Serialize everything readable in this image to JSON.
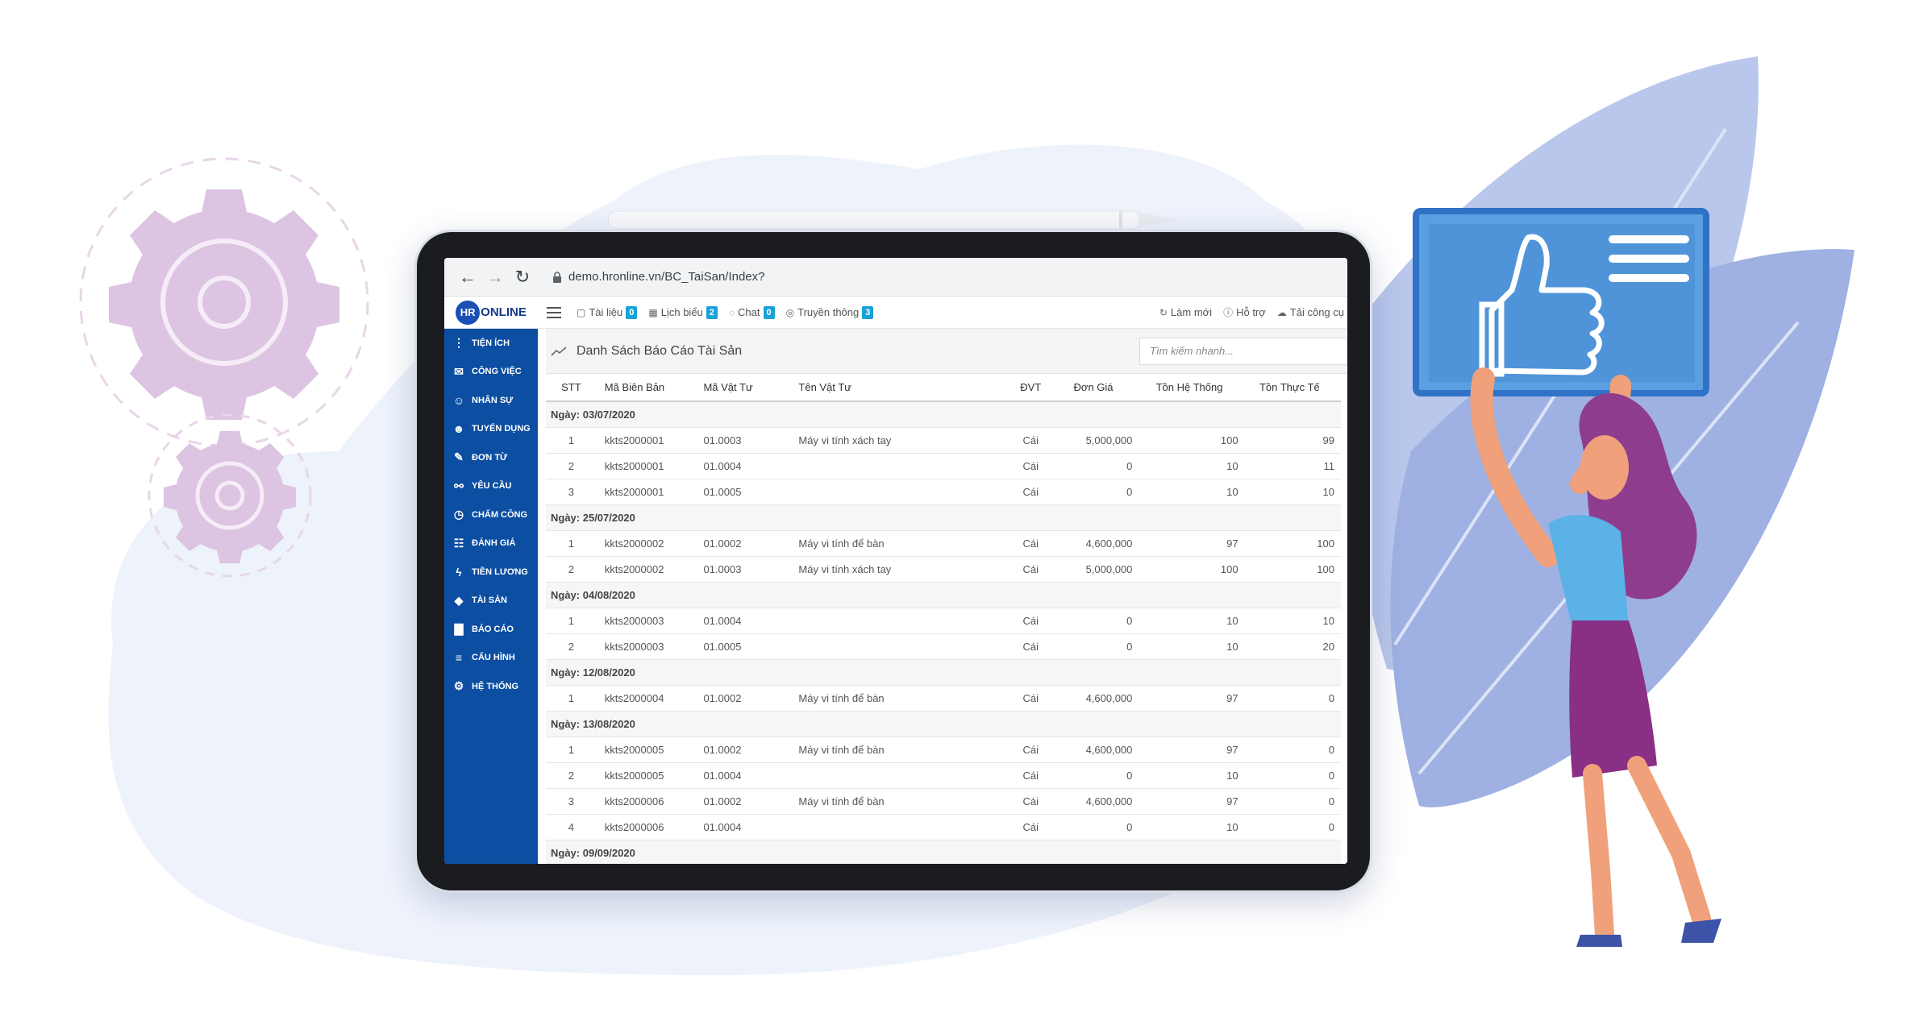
{
  "browser": {
    "url": "demo.hronline.vn/BC_TaiSan/Index?"
  },
  "app": {
    "logo_hr": "HR",
    "logo_text": "ONLINE",
    "menu": [
      {
        "icon": "folder-icon",
        "label": "Tài liệu",
        "badge": "0"
      },
      {
        "icon": "calendar-icon",
        "label": "Lịch biểu",
        "badge": "2"
      },
      {
        "icon": "chat-icon",
        "label": "Chat",
        "badge": "0"
      },
      {
        "icon": "globe-icon",
        "label": "Truyền thông",
        "badge": "3"
      }
    ],
    "right_menu": [
      {
        "icon": "refresh-icon",
        "label": "Làm mới"
      },
      {
        "icon": "info-icon",
        "label": "Hỗ trợ"
      },
      {
        "icon": "cloud-icon",
        "label": "Tải công cụ"
      }
    ]
  },
  "sidebar": {
    "items": [
      {
        "icon": "more-vertical-icon",
        "label": "TIỆN ÍCH"
      },
      {
        "icon": "inbox-icon",
        "label": "CÔNG VIỆC"
      },
      {
        "icon": "user-icon",
        "label": "NHÂN SỰ"
      },
      {
        "icon": "user-add-icon",
        "label": "TUYỂN DỤNG"
      },
      {
        "icon": "edit-icon",
        "label": "ĐƠN TỪ"
      },
      {
        "icon": "link-icon",
        "label": "YÊU CẦU"
      },
      {
        "icon": "clock-icon",
        "label": "CHẤM CÔNG"
      },
      {
        "icon": "book-icon",
        "label": "ĐÁNH GIÁ"
      },
      {
        "icon": "bolt-icon",
        "label": "TIỀN LƯƠNG"
      },
      {
        "icon": "diamond-icon",
        "label": "TÀI SẢN"
      },
      {
        "icon": "bar-chart-icon",
        "label": "BÁO CÁO"
      },
      {
        "icon": "layers-icon",
        "label": "CẤU HÌNH"
      },
      {
        "icon": "gear-icon",
        "label": "HỆ THỐNG"
      }
    ]
  },
  "main": {
    "title": "Danh Sách Báo Cáo Tài Sản",
    "search_placeholder": "Tìm kiếm nhanh...",
    "columns": [
      "STT",
      "Mã Biên Bản",
      "Mã Vật Tư",
      "Tên Vật Tư",
      "ĐVT",
      "Đơn Giá",
      "Tồn Hệ Thống",
      "Tồn Thực Tế"
    ],
    "groups": [
      {
        "date": "Ngày: 03/07/2020",
        "rows": [
          [
            "1",
            "kkts2000001",
            "01.0003",
            "Máy vi tính xách tay",
            "Cái",
            "5,000,000",
            "100",
            "99"
          ],
          [
            "2",
            "kkts2000001",
            "01.0004",
            "",
            "Cái",
            "0",
            "10",
            "11"
          ],
          [
            "3",
            "kkts2000001",
            "01.0005",
            "",
            "Cái",
            "0",
            "10",
            "10"
          ]
        ]
      },
      {
        "date": "Ngày: 25/07/2020",
        "rows": [
          [
            "1",
            "kkts2000002",
            "01.0002",
            "Máy vi tính để bàn",
            "Cái",
            "4,600,000",
            "97",
            "100"
          ],
          [
            "2",
            "kkts2000002",
            "01.0003",
            "Máy vi tính xách tay",
            "Cái",
            "5,000,000",
            "100",
            "100"
          ]
        ]
      },
      {
        "date": "Ngày: 04/08/2020",
        "rows": [
          [
            "1",
            "kkts2000003",
            "01.0004",
            "",
            "Cái",
            "0",
            "10",
            "10"
          ],
          [
            "2",
            "kkts2000003",
            "01.0005",
            "",
            "Cái",
            "0",
            "10",
            "20"
          ]
        ]
      },
      {
        "date": "Ngày: 12/08/2020",
        "rows": [
          [
            "1",
            "kkts2000004",
            "01.0002",
            "Máy vi tính để bàn",
            "Cái",
            "4,600,000",
            "97",
            "0"
          ]
        ]
      },
      {
        "date": "Ngày: 13/08/2020",
        "rows": [
          [
            "1",
            "kkts2000005",
            "01.0002",
            "Máy vi tính để bàn",
            "Cái",
            "4,600,000",
            "97",
            "0"
          ],
          [
            "2",
            "kkts2000005",
            "01.0004",
            "",
            "Cái",
            "0",
            "10",
            "0"
          ],
          [
            "3",
            "kkts2000006",
            "01.0002",
            "Máy vi tính để bàn",
            "Cái",
            "4,600,000",
            "97",
            "0"
          ],
          [
            "4",
            "kkts2000006",
            "01.0004",
            "",
            "Cái",
            "0",
            "10",
            "0"
          ]
        ]
      },
      {
        "date": "Ngày: 09/09/2020",
        "rows": []
      }
    ]
  },
  "colors": {
    "sidebar": "#0b4ea2",
    "badge": "#17a2d8",
    "blob": "#eaf0fa",
    "leaf": "#a9b9e6"
  }
}
